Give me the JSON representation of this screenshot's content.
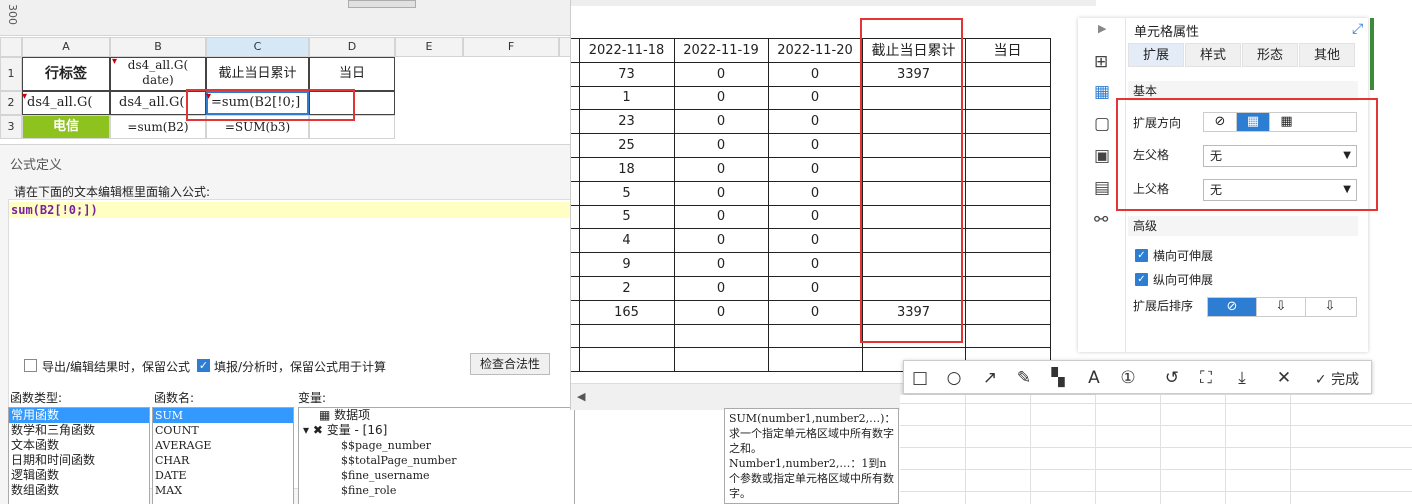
{
  "sheet": {
    "toolbar_vertical": "300",
    "columns": [
      "A",
      "B",
      "C",
      "D",
      "E",
      "F"
    ],
    "rows": [
      "1",
      "2",
      "3"
    ],
    "r1": {
      "a": "行标签",
      "b": "ds4_all.G(\ndate)",
      "c": "截止当日累计",
      "d": "当日"
    },
    "r2": {
      "a": "ds4_all.G(",
      "b": "ds4_all.G(",
      "c": "=sum(B2[!0;]"
    },
    "r3": {
      "a": "电信",
      "b": "=sum(B2)",
      "c": "=SUM(b3)"
    }
  },
  "dialog": {
    "title": "公式定义",
    "instruction": "请在下面的文本编辑框里面输入公式:",
    "formula": "sum(B2[!0;])",
    "opt_export": "导出/编辑结果时，保留公式",
    "opt_fill": "填报/分析时，保留公式用于计算",
    "check_btn": "检查合法性",
    "fn_type_label": "函数类型:",
    "fn_name_label": "函数名:",
    "var_label": "变量:",
    "fn_types": [
      "常用函数",
      "数学和三角函数",
      "文本函数",
      "日期和时间函数",
      "逻辑函数",
      "数组函数"
    ],
    "fn_names": [
      "SUM",
      "COUNT",
      "AVERAGE",
      "CHAR",
      "DATE",
      "MAX"
    ],
    "vars_head1": "数据项",
    "vars_head2": "变量 - [16]",
    "vars": [
      "$$page_number",
      "$$totalPage_number",
      "$fine_username",
      "$fine_role"
    ]
  },
  "preview": {
    "headers": [
      "2022-11-18",
      "2022-11-19",
      "2022-11-20",
      "截止当日累计",
      "当日"
    ],
    "rows": [
      [
        "73",
        "0",
        "0",
        "3397",
        ""
      ],
      [
        "1",
        "0",
        "0",
        "",
        ""
      ],
      [
        "23",
        "0",
        "0",
        "",
        ""
      ],
      [
        "25",
        "0",
        "0",
        "",
        ""
      ],
      [
        "18",
        "0",
        "0",
        "",
        ""
      ],
      [
        "5",
        "0",
        "0",
        "",
        ""
      ],
      [
        "5",
        "0",
        "0",
        "",
        ""
      ],
      [
        "4",
        "0",
        "0",
        "",
        ""
      ],
      [
        "9",
        "0",
        "0",
        "",
        ""
      ],
      [
        "2",
        "0",
        "0",
        "",
        ""
      ],
      [
        "165",
        "0",
        "0",
        "3397",
        ""
      ],
      [
        "",
        "",
        "",
        "",
        ""
      ],
      [
        "",
        "",
        "",
        "",
        ""
      ]
    ]
  },
  "snip_toolbar": {
    "done": "完成"
  },
  "props": {
    "title": "单元格属性",
    "tabs": [
      "扩展",
      "样式",
      "形态",
      "其他"
    ],
    "basic": "基本",
    "dir_label": "扩展方向",
    "left_parent_label": "左父格",
    "left_parent_value": "无",
    "top_parent_label": "上父格",
    "top_parent_value": "无",
    "advanced": "高级",
    "h_expand": "横向可伸展",
    "v_expand": "纵向可伸展",
    "sort_label": "扩展后排序"
  },
  "help": {
    "text1": "SUM(number1,number2,…)：求一个指定单元格区域中所有数字之和。",
    "text2": "Number1,number2,…：1到n个参数或指定单元格区域中所有数字。"
  },
  "colors": {
    "highlight": "#e23636",
    "accent": "#2d7dd2",
    "green": "#8dc21f"
  }
}
